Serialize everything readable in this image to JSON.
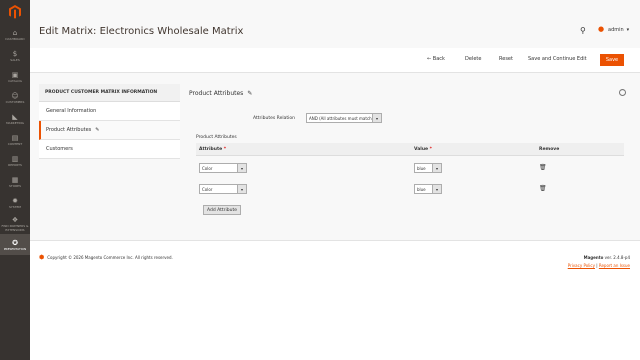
{
  "sidebar": {
    "items": [
      {
        "icon": "dashboard-icon",
        "glyph": "⌂",
        "label": "DASHBOARD"
      },
      {
        "icon": "dollar-icon",
        "glyph": "$",
        "label": "SALES"
      },
      {
        "icon": "cube-icon",
        "glyph": "▣",
        "label": "CATALOG"
      },
      {
        "icon": "person-icon",
        "glyph": "☺",
        "label": "CUSTOMERS"
      },
      {
        "icon": "megaphone-icon",
        "glyph": "◣",
        "label": "MARKETING"
      },
      {
        "icon": "content-icon",
        "glyph": "▤",
        "label": "CONTENT"
      },
      {
        "icon": "bar-chart-icon",
        "glyph": "▥",
        "label": "REPORTS"
      },
      {
        "icon": "store-icon",
        "glyph": "▦",
        "label": "STORES"
      },
      {
        "icon": "gear-icon",
        "glyph": "✹",
        "label": "SYSTEM"
      },
      {
        "icon": "extensions-icon",
        "glyph": "❖",
        "label": "FIND PARTNERS & EXTENSIONS"
      },
      {
        "icon": "presentation-icon",
        "glyph": "✪",
        "label": "PRESENTATION"
      }
    ]
  },
  "header": {
    "title": "Edit Matrix: Electronics Wholesale Matrix",
    "user": "admin"
  },
  "actions": {
    "back": "Back",
    "delete": "Delete",
    "reset": "Reset",
    "save_continue": "Save and Continue Edit",
    "save": "Save"
  },
  "tabs": {
    "heading": "PRODUCT CUSTOMER MATRIX INFORMATION",
    "items": [
      "General Information",
      "Product Attributes",
      "Customers"
    ]
  },
  "section": {
    "title": "Product Attributes",
    "relation_label": "Attributes Relation",
    "relation_value": "AND (All attributes must match)",
    "grid_caption": "Product Attributes",
    "columns": {
      "attribute": "Attribute",
      "value": "Value",
      "remove": "Remove"
    },
    "rows": [
      {
        "attribute": "Color",
        "value": "blue"
      },
      {
        "attribute": "Color",
        "value": "blue"
      }
    ],
    "add_button": "Add Attribute"
  },
  "footer": {
    "copyright": "Copyright © 2026 Magento Commerce Inc. All rights reserved.",
    "brand": "Magento",
    "version": "ver. 2.4.8-p4",
    "privacy": "Privacy Policy",
    "report": "Report an Issue"
  },
  "colors": {
    "accent": "#eb5202",
    "sidebar": "#373330"
  }
}
